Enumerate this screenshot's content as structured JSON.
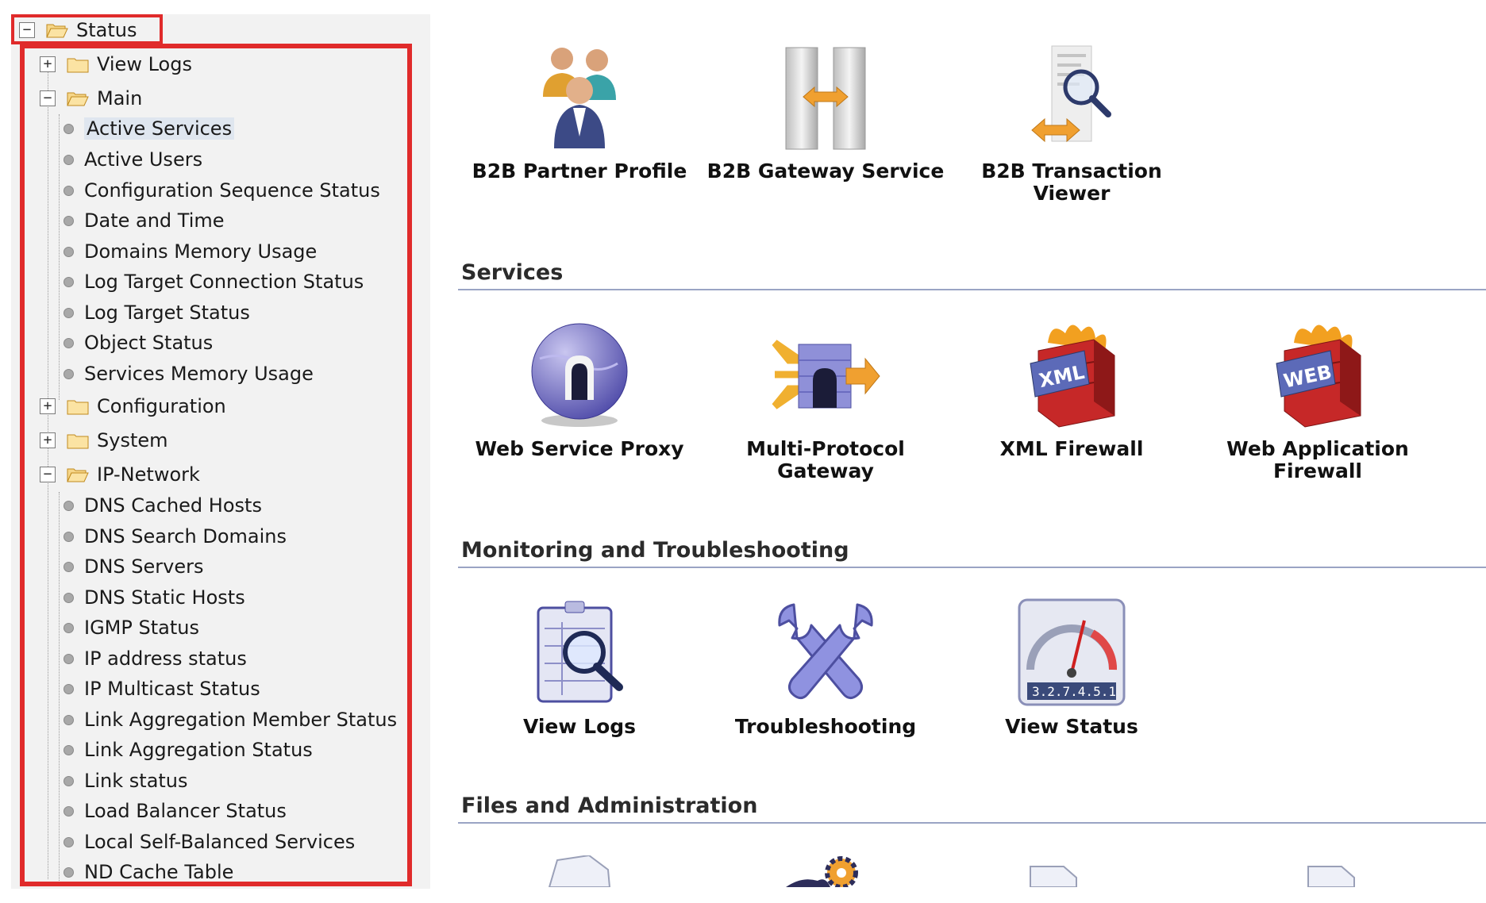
{
  "sidebar": {
    "root": {
      "label": "Status",
      "toggle": "−"
    },
    "view_logs": {
      "label": "View Logs",
      "toggle": "+"
    },
    "main": {
      "label": "Main",
      "toggle": "−"
    },
    "main_items": [
      "Active Services",
      "Active Users",
      "Configuration Sequence Status",
      "Date and Time",
      "Domains Memory Usage",
      "Log Target Connection Status",
      "Log Target Status",
      "Object Status",
      "Services Memory Usage"
    ],
    "configuration": {
      "label": "Configuration",
      "toggle": "+"
    },
    "system": {
      "label": "System",
      "toggle": "+"
    },
    "ip_network": {
      "label": "IP-Network",
      "toggle": "−"
    },
    "ip_items": [
      "DNS Cached Hosts",
      "DNS Search Domains",
      "DNS Servers",
      "DNS Static Hosts",
      "IGMP Status",
      "IP address status",
      "IP Multicast Status",
      "Link Aggregation Member Status",
      "Link Aggregation Status",
      "Link status",
      "Load Balancer Status",
      "Local Self-Balanced Services",
      "ND Cache Table"
    ],
    "selected_item": "Active Services",
    "highlight_color": "#e02b2b"
  },
  "b2b": {
    "tiles": [
      {
        "label": "B2B Partner Profile",
        "icon": "people-icon"
      },
      {
        "label": "B2B Gateway Service",
        "icon": "gateway-towers-icon"
      },
      {
        "label_line1": "B2B Transaction",
        "label_line2": "Viewer",
        "icon": "transaction-viewer-icon"
      }
    ]
  },
  "services": {
    "title": "Services",
    "tiles": [
      {
        "label": "Web Service Proxy",
        "icon": "globe-icon"
      },
      {
        "label_line1": "Multi-Protocol",
        "label_line2": "Gateway",
        "icon": "multi-protocol-gateway-icon"
      },
      {
        "label": "XML Firewall",
        "icon": "xml-firewall-icon"
      },
      {
        "label_line1": "Web Application",
        "label_line2": "Firewall",
        "icon": "web-firewall-icon"
      }
    ]
  },
  "monitoring": {
    "title": "Monitoring and Troubleshooting",
    "tiles": [
      {
        "label": "View Logs",
        "icon": "log-magnifier-icon"
      },
      {
        "label": "Troubleshooting",
        "icon": "wrenches-icon"
      },
      {
        "label": "View Status",
        "icon": "gauge-icon",
        "counter": "3.2.7.4.5.1"
      }
    ]
  },
  "files": {
    "title": "Files and Administration"
  },
  "colors": {
    "accent": "#9aa4c4",
    "selected_bg": "#dfe6ef"
  }
}
